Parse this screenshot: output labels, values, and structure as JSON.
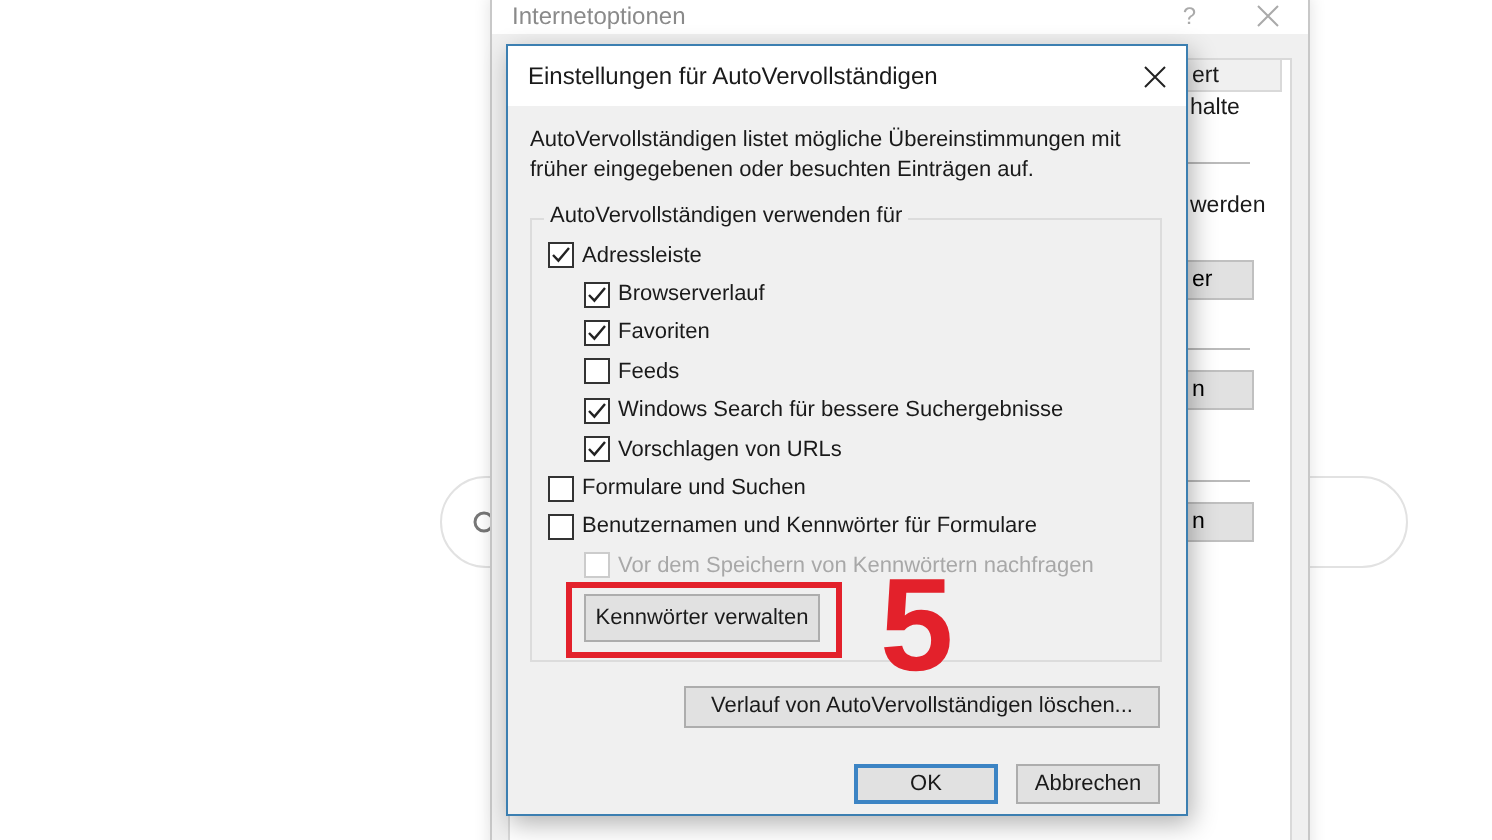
{
  "main_window": {
    "title": "Internetoptionen",
    "help": "?",
    "tab": "ert",
    "fragments": [
      "halte",
      "werden"
    ],
    "buttons": [
      "er",
      "n",
      "n"
    ]
  },
  "dialog": {
    "title": "Einstellungen für AutoVervollständigen",
    "description": "AutoVervollständigen listet mögliche Übereinstimmungen mit früher eingegebenen oder besuchten Einträgen auf.",
    "group_label": "AutoVervollständigen verwenden für",
    "options": [
      {
        "label": "Adressleiste",
        "checked": true,
        "disabled": false,
        "children": [
          {
            "label": "Browserverlauf",
            "checked": true,
            "disabled": false
          },
          {
            "label": "Favoriten",
            "checked": true,
            "disabled": false
          },
          {
            "label": "Feeds",
            "checked": false,
            "disabled": false
          },
          {
            "label": "Windows Search für bessere Suchergebnisse",
            "checked": true,
            "disabled": false
          },
          {
            "label": "Vorschlagen von URLs",
            "checked": true,
            "disabled": false
          }
        ]
      },
      {
        "label": "Formulare und Suchen",
        "checked": false,
        "disabled": false
      },
      {
        "label": "Benutzernamen und Kennwörter für Formulare",
        "checked": false,
        "disabled": false,
        "children": [
          {
            "label": "Vor dem Speichern von Kennwörtern nachfragen",
            "checked": false,
            "disabled": true
          }
        ]
      }
    ],
    "manage_button": "Kennwörter verwalten",
    "clear_button": "Verlauf von AutoVervollständigen löschen...",
    "buttons": [
      {
        "label": "OK",
        "default": true
      },
      {
        "label": "Abbrechen",
        "default": false
      }
    ]
  },
  "annotation": {
    "number": "5"
  }
}
